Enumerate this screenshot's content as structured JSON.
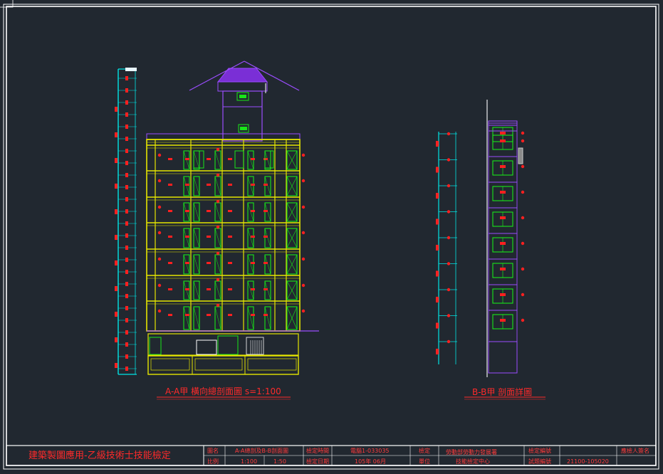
{
  "drawing": {
    "section_a_title": "A-A甲 橫向總剖面圖 s=1:100",
    "section_b_title": "B-B甲 剖面詳圖"
  },
  "title_block": {
    "main_title": "建築製圖應用-乙級技術士技能檢定",
    "cells": {
      "r1_label1": "圖名",
      "r1_value1": "A-A總剖及B-B剖面圖",
      "r1_label2": "檢定時間",
      "r1_value2": "電腦1-033035",
      "r1_label3": "檢定",
      "r1_value3a": "勞動部勞動力發展署",
      "r1_label4": "檢定編號",
      "r1_label5": "應檢人簽名",
      "r2_label1": "比例",
      "r2_value1a": "1:100",
      "r2_value1b": "1:50",
      "r2_label2": "檢定日期",
      "r2_value2": "105年 06月",
      "r2_label3": "單位",
      "r2_value3b": "技能檢定中心",
      "r2_label4": "試題編號",
      "r2_value4": "21100-105020"
    }
  },
  "colors": {
    "background": "#212830",
    "frame": "#ffffff",
    "structure": "#e6e600",
    "roof": "#7a2fd6",
    "openings": "#19e619",
    "dimension": "#00e5e5",
    "annotation": "#ff2020"
  }
}
